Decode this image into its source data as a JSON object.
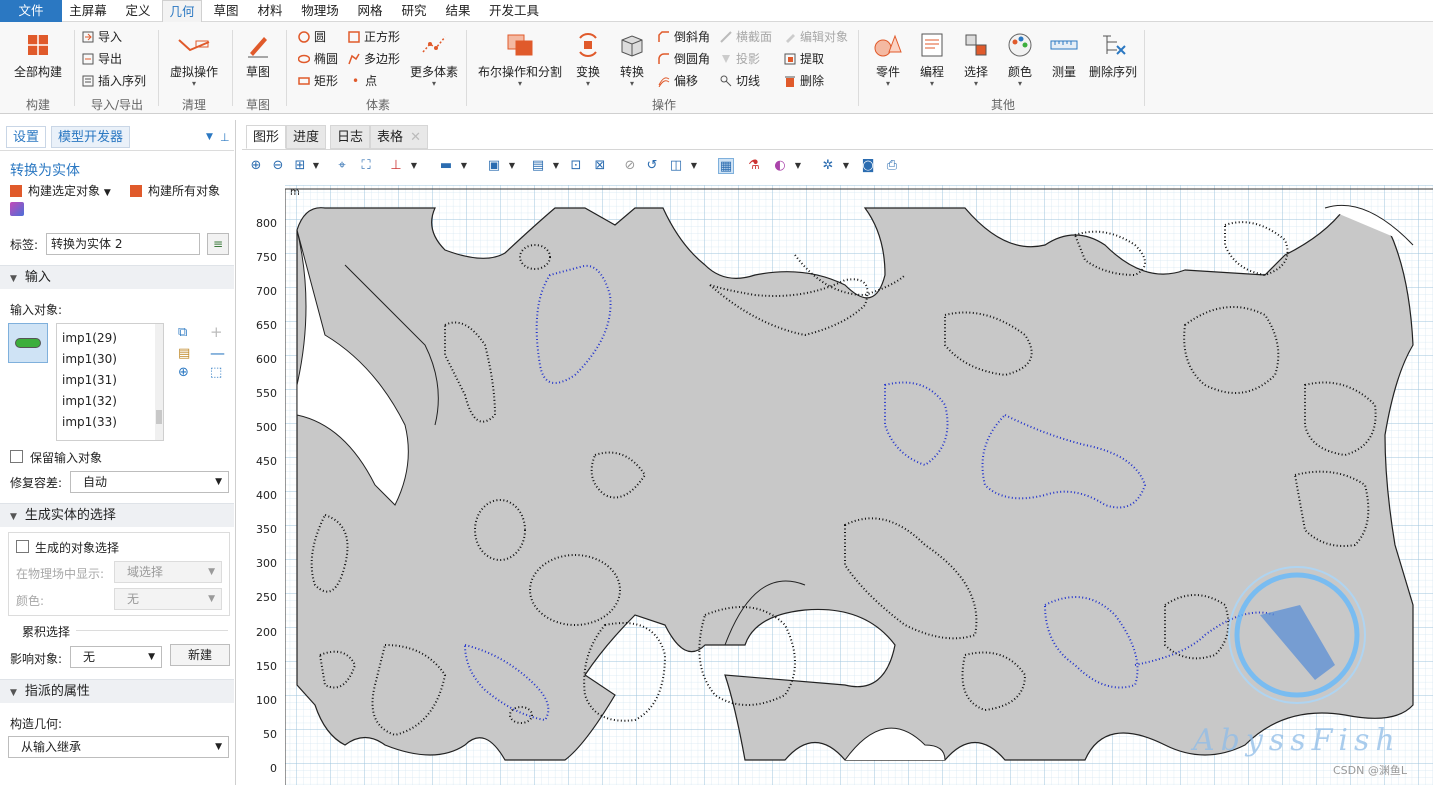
{
  "menu": {
    "items": [
      "文件",
      "主屏幕",
      "定义",
      "几何",
      "草图",
      "材料",
      "物理场",
      "网格",
      "研究",
      "结果",
      "开发工具"
    ],
    "active": "几何"
  },
  "ribbon": {
    "groups": [
      "构建",
      "导入/导出",
      "清理",
      "草图",
      "体素",
      "操作",
      "其他"
    ],
    "build_all": "全部构建",
    "import": "导入",
    "export": "导出",
    "insert_sequence": "插入序列",
    "virtual_ops": "虚拟操作",
    "sketch": "草图",
    "circle": "圆",
    "square": "正方形",
    "ellipse": "椭圆",
    "polygon": "多边形",
    "rectangle": "矩形",
    "point": "点",
    "more_primitives": "更多体素",
    "boolean": "布尔操作和分割",
    "transform": "变换",
    "convert": "转换",
    "chamfer": "倒斜角",
    "fillet": "倒圆角",
    "offset": "偏移",
    "cross_section": "横截面",
    "projection": "投影",
    "tangent": "切线",
    "edit_object": "编辑对象",
    "extract": "提取",
    "delete": "删除",
    "parts": "零件",
    "programming": "编程",
    "selection": "选择",
    "color": "颜色",
    "measure": "测量",
    "delete_sequence": "删除序列"
  },
  "left": {
    "tabs": [
      "设置",
      "模型开发器"
    ],
    "title": "转换为实体",
    "build_selected": "构建选定对象",
    "build_all": "构建所有对象",
    "label_caption": "标签:",
    "label_value": "转换为实体 2",
    "input_section": "输入",
    "input_objects_caption": "输入对象:",
    "input_list": [
      "imp1(29)",
      "imp1(30)",
      "imp1(31)",
      "imp1(32)",
      "imp1(33)"
    ],
    "keep_input": "保留输入对象",
    "repair_tol_caption": "修复容差:",
    "repair_tol_value": "自动",
    "gen_sel_section": "生成实体的选择",
    "gen_obj_sel": "生成的对象选择",
    "show_in_physics_caption": "在物理场中显示:",
    "show_in_physics_value": "域选择",
    "color_caption": "颜色:",
    "color_value": "无",
    "cumulative_sel": "累积选择",
    "contribute_caption": "影响对象:",
    "contribute_value": "无",
    "new_button": "新建",
    "derived_section": "指派的属性",
    "construct_geom_caption": "构造几何:",
    "construct_geom_value": "从输入继承"
  },
  "graphics": {
    "tabs": [
      "图形",
      "进度",
      "日志",
      "表格"
    ],
    "unit": "m",
    "y_ticks": [
      "800",
      "750",
      "700",
      "650",
      "600",
      "550",
      "500",
      "450",
      "400",
      "350",
      "300",
      "250",
      "200",
      "150",
      "100",
      "50",
      "0"
    ],
    "watermark": "AbyssFish",
    "credit": "CSDN @渊鱼L"
  },
  "colors": {
    "accent": "#2b78c2",
    "geometry_fill": "#c8c8c8",
    "grid_major": "#9fc4dd",
    "grid_minor": "#d5e6f2",
    "curve_blue": "#2233cc"
  }
}
